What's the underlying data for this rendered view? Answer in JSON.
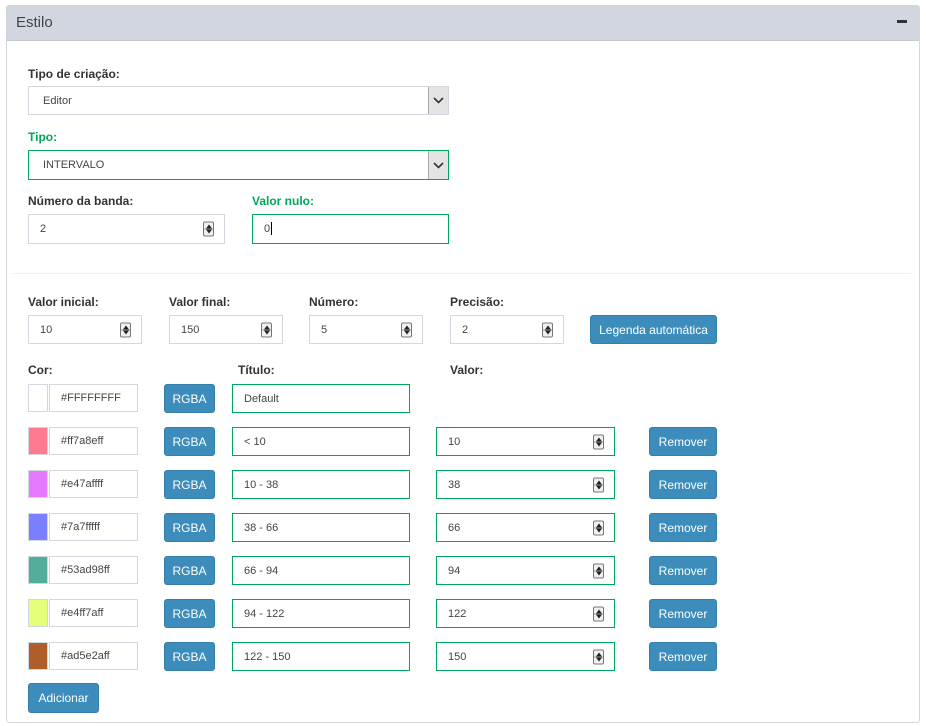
{
  "panel": {
    "title": "Estilo",
    "collapse_icon": "minus-icon"
  },
  "tipo_criacao": {
    "label": "Tipo de criação:",
    "value": "Editor"
  },
  "tipo": {
    "label": "Tipo:",
    "value": "INTERVALO"
  },
  "numero_banda": {
    "label": "Número da banda:",
    "value": "2"
  },
  "valor_nulo": {
    "label": "Valor nulo:",
    "value": "0"
  },
  "auto": {
    "valor_inicial": {
      "label": "Valor inicial:",
      "value": "10"
    },
    "valor_final": {
      "label": "Valor final:",
      "value": "150"
    },
    "numero": {
      "label": "Número:",
      "value": "5"
    },
    "precisao": {
      "label": "Precisão:",
      "value": "2"
    },
    "legend_button": "Legenda automática"
  },
  "table": {
    "headers": {
      "cor": "Cor:",
      "titulo": "Título:",
      "valor": "Valor:"
    },
    "rgba_label": "RGBA",
    "remove_label": "Remover",
    "rows": [
      {
        "swatch": "#FFFFFF",
        "color": "#FFFFFFFF",
        "title": "Default",
        "value": null
      },
      {
        "swatch": "#ff7a8e",
        "color": "#ff7a8eff",
        "title": "< 10",
        "value": "10"
      },
      {
        "swatch": "#e47aff",
        "color": "#e47affff",
        "title": "10 - 38",
        "value": "38"
      },
      {
        "swatch": "#7a7fff",
        "color": "#7a7fffff",
        "title": "38 - 66",
        "value": "66"
      },
      {
        "swatch": "#53ad98",
        "color": "#53ad98ff",
        "title": "66 - 94",
        "value": "94"
      },
      {
        "swatch": "#e4ff7a",
        "color": "#e4ff7aff",
        "title": "94 - 122",
        "value": "122"
      },
      {
        "swatch": "#ad5e2a",
        "color": "#ad5e2aff",
        "title": "122 - 150",
        "value": "150"
      }
    ]
  },
  "add_button": "Adicionar",
  "colors": {
    "accent": "#3c8dbc",
    "success": "#00a65a",
    "header_bg": "#d2d6de"
  }
}
